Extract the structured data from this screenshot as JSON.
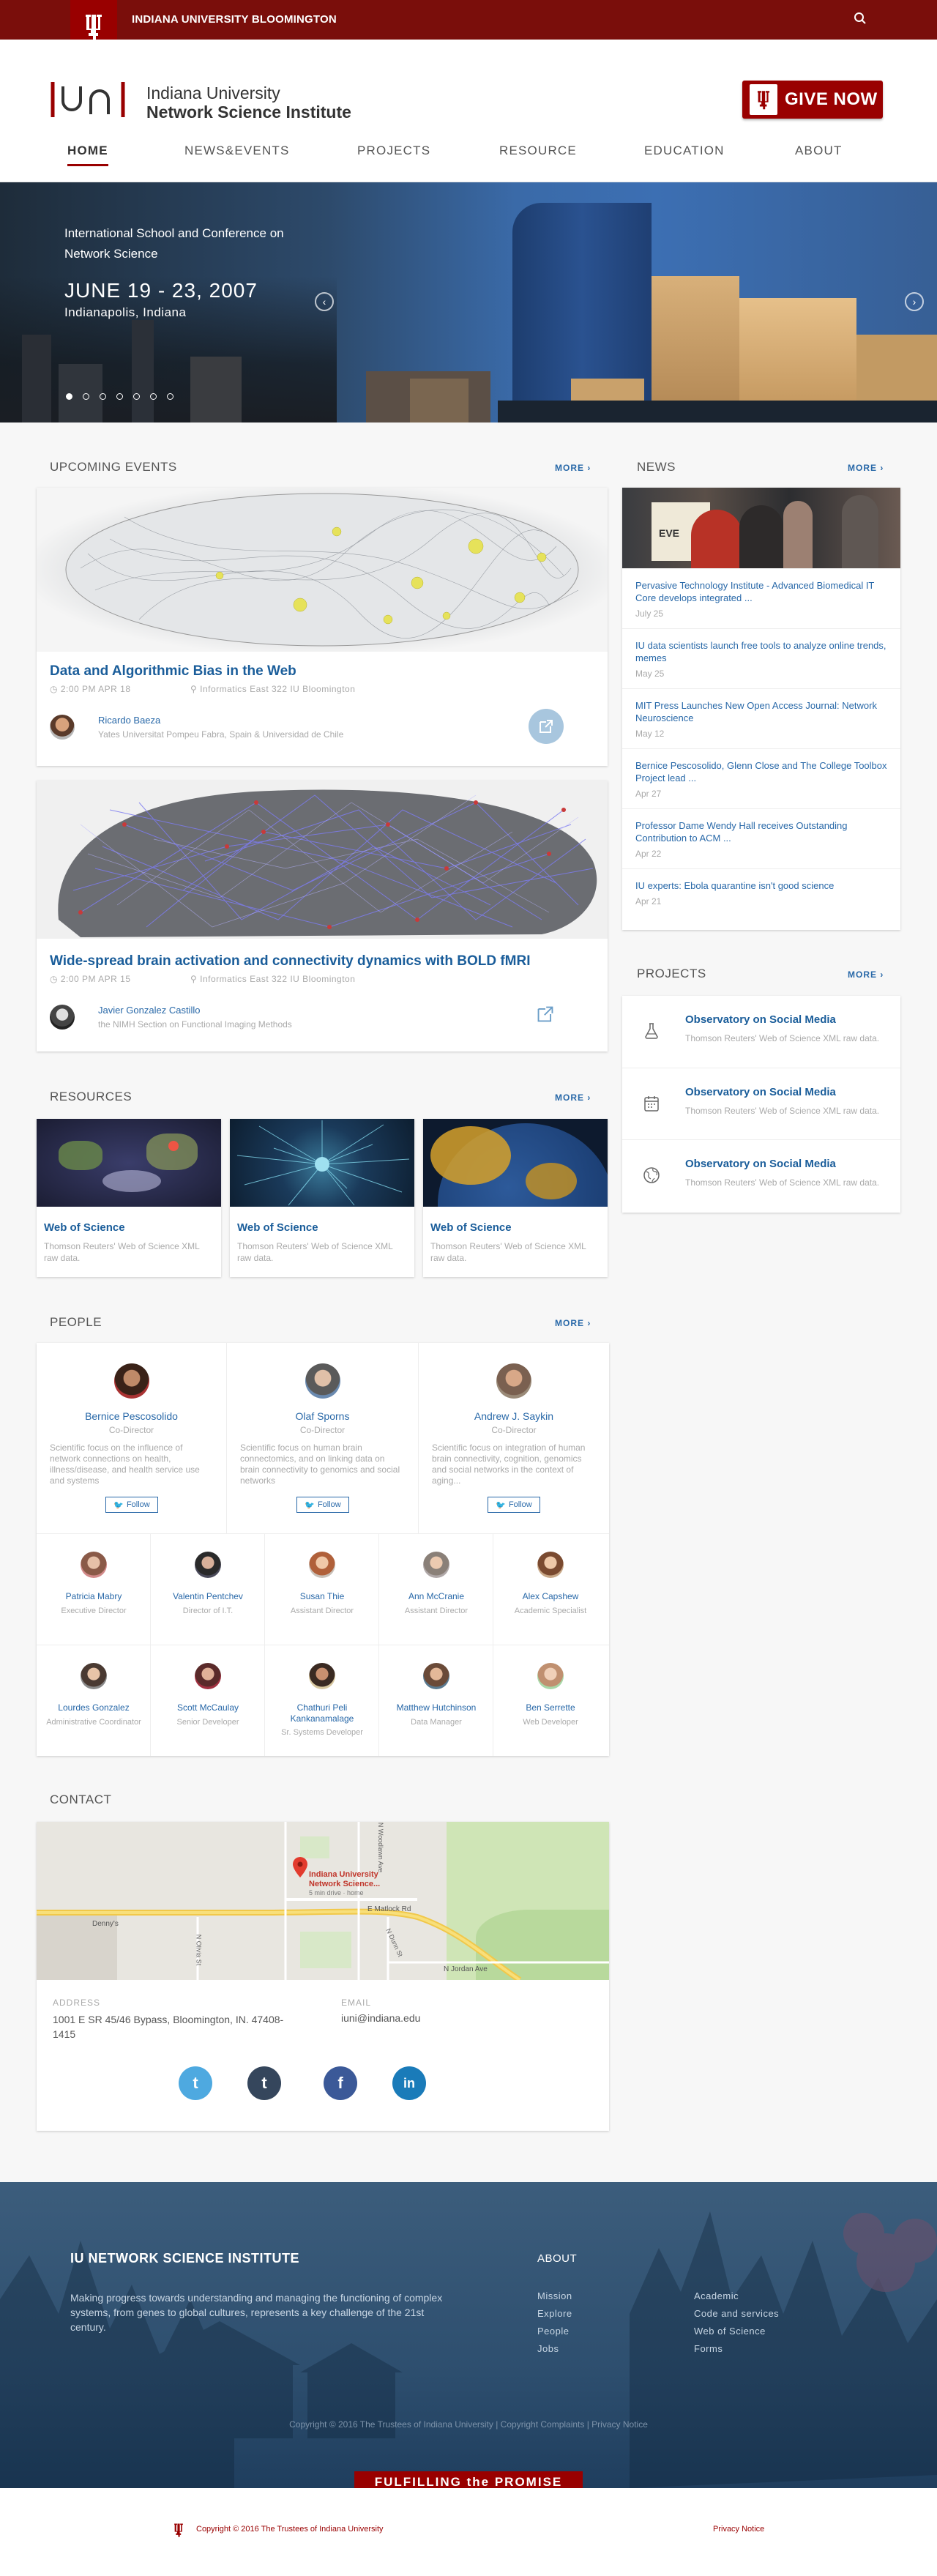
{
  "topbar": {
    "title": "INDIANA UNIVERSITY BLOOMINGTON"
  },
  "header": {
    "org_line1": "Indiana University",
    "org_line2": "Network Science Institute",
    "give_label": "GIVE NOW"
  },
  "nav": [
    "HOME",
    "NEWS&EVENTS",
    "PROJECTS",
    "RESOURCE",
    "EDUCATION",
    "ABOUT"
  ],
  "hero": {
    "subtitle": "International School and Conference on Network Science",
    "date": "JUNE 19 - 23, 2007",
    "place": "Indianapolis, Indiana",
    "dots": 7,
    "active_dot": 0
  },
  "events": {
    "heading": "UPCOMING EVENTS",
    "more": "MORE ›",
    "items": [
      {
        "title": "Data and Algorithmic Bias in the Web",
        "time": "2:00 PM  APR 18",
        "location": "Informatics East 322  IU Bloomington",
        "speaker": "Ricardo Baeza",
        "affiliation": "Yates Universitat Pompeu Fabra, Spain & Universidad de Chile"
      },
      {
        "title": "Wide-spread brain activation and connectivity dynamics with BOLD fMRI",
        "time": "2:00 PM  APR 15",
        "location": "Informatics East 322  IU Bloomington",
        "speaker": "Javier Gonzalez Castillo",
        "affiliation": "the NIMH Section on Functional Imaging Methods"
      }
    ]
  },
  "news": {
    "heading": "NEWS",
    "more": "MORE ›",
    "items": [
      {
        "title": "Pervasive Technology Institute - Advanced Biomedical IT Core develops integrated ...",
        "date": "July 25"
      },
      {
        "title": "IU data scientists launch free tools to analyze online trends, memes",
        "date": "May 25"
      },
      {
        "title": "MIT Press Launches New Open Access Journal: Network Neuroscience",
        "date": "May 12"
      },
      {
        "title": "Bernice Pescosolido, Glenn Close and The College Toolbox Project lead ...",
        "date": "Apr 27"
      },
      {
        "title": "Professor Dame Wendy Hall receives Outstanding Contribution to ACM ...",
        "date": "Apr 22"
      },
      {
        "title": "IU experts: Ebola quarantine isn't good science",
        "date": "Apr 21"
      }
    ]
  },
  "projects": {
    "heading": "PROJECTS",
    "more": "MORE ›",
    "items": [
      {
        "title": "Observatory on Social Media",
        "desc": "Thomson Reuters' Web of Science XML raw data.",
        "icon": "flask-icon"
      },
      {
        "title": "Observatory on Social Media",
        "desc": "Thomson Reuters' Web of Science XML raw data.",
        "icon": "calendar-icon"
      },
      {
        "title": "Observatory on Social Media",
        "desc": "Thomson Reuters' Web of Science XML raw data.",
        "icon": "globe-icon"
      }
    ]
  },
  "resources": {
    "heading": "RESOURCES",
    "more": "MORE ›",
    "items": [
      {
        "title": "Web of Science",
        "desc": "Thomson Reuters' Web of Science XML raw data."
      },
      {
        "title": "Web of Science",
        "desc": "Thomson Reuters' Web of Science XML raw data."
      },
      {
        "title": "Web of Science",
        "desc": "Thomson Reuters' Web of Science XML raw data."
      }
    ]
  },
  "people": {
    "heading": "PEOPLE",
    "more": "MORE ›",
    "follow": "Follow",
    "leads": [
      {
        "name": "Bernice Pescosolido",
        "role": "Co-Director",
        "desc": "Scientific focus on the influence of network connections on health, illness/disease, and health service use and systems"
      },
      {
        "name": "Olaf Sporns",
        "role": "Co-Director",
        "desc": "Scientific focus on human brain connectomics, and on linking data on brain connectivity to genomics and social networks"
      },
      {
        "name": "Andrew J. Saykin",
        "role": "Co-Director",
        "desc": "Scientific focus on integration of human brain connectivity, cognition, genomics and social networks in the context of aging..."
      }
    ],
    "staff_row1": [
      {
        "name": "Patricia Mabry",
        "role": "Executive Director"
      },
      {
        "name": "Valentin Pentchev",
        "role": "Director of I.T."
      },
      {
        "name": "Susan Thie",
        "role": "Assistant Director"
      },
      {
        "name": "Ann McCranie",
        "role": "Assistant Director"
      },
      {
        "name": "Alex Capshew",
        "role": "Academic Specialist"
      }
    ],
    "staff_row2": [
      {
        "name": "Lourdes Gonzalez",
        "role": "Administrative Coordinator"
      },
      {
        "name": "Scott McCaulay",
        "role": "Senior Developer"
      },
      {
        "name": "Chathuri Peli Kankanamalage",
        "role": "Sr. Systems Developer"
      },
      {
        "name": "Matthew Hutchinson",
        "role": "Data Manager"
      },
      {
        "name": "Ben Serrette",
        "role": "Web Developer"
      }
    ]
  },
  "contact": {
    "heading": "CONTACT",
    "map_pin_label": "Indiana University Network Science...",
    "map_pin_sub": "5 min drive · home",
    "map_streets": [
      "E Matlock Rd",
      "Denny's",
      "N Olivia St",
      "N Jordan Ave",
      "N Woodlawn Ave",
      "N Dunn St"
    ],
    "address_label": "ADDRESS",
    "address": "1001 E SR 45/46 Bypass, Bloomington, IN. 47408-1415",
    "email_label": "EMAIL",
    "email": "iuni@indiana.edu",
    "social": [
      {
        "name": "twitter",
        "color": "#4ea9e0",
        "glyph": "t"
      },
      {
        "name": "tumblr",
        "color": "#35465c",
        "glyph": "t"
      },
      {
        "name": "facebook",
        "color": "#3b5998",
        "glyph": "f"
      },
      {
        "name": "linkedin",
        "color": "#1a7bb9",
        "glyph": "in"
      }
    ]
  },
  "footer": {
    "title": "IU NETWORK SCIENCE INSTITUTE",
    "mission": "Making progress towards understanding and managing the functioning of complex systems, from genes to global cultures, represents a key challenge of the 21st century.",
    "about_heading": "ABOUT",
    "col1": [
      "Mission",
      "Explore",
      "People",
      "Jobs"
    ],
    "col2": [
      "Academic",
      "Code and services",
      "Web of Science",
      "Forms"
    ],
    "copyright": "Copyright © 2016 The Trustees of Indiana University | Copyright Complaints | Privacy Notice",
    "banner": "FULFILLING the PROMISE"
  },
  "bottom": {
    "copyright_prefix": "Copyright © 2016 The Trustees of ",
    "copyright_link": "Indiana University",
    "privacy": "Privacy Notice"
  },
  "colors": {
    "crimson": "#990000",
    "link": "#2868a8",
    "footer": "#2e4f6f"
  }
}
